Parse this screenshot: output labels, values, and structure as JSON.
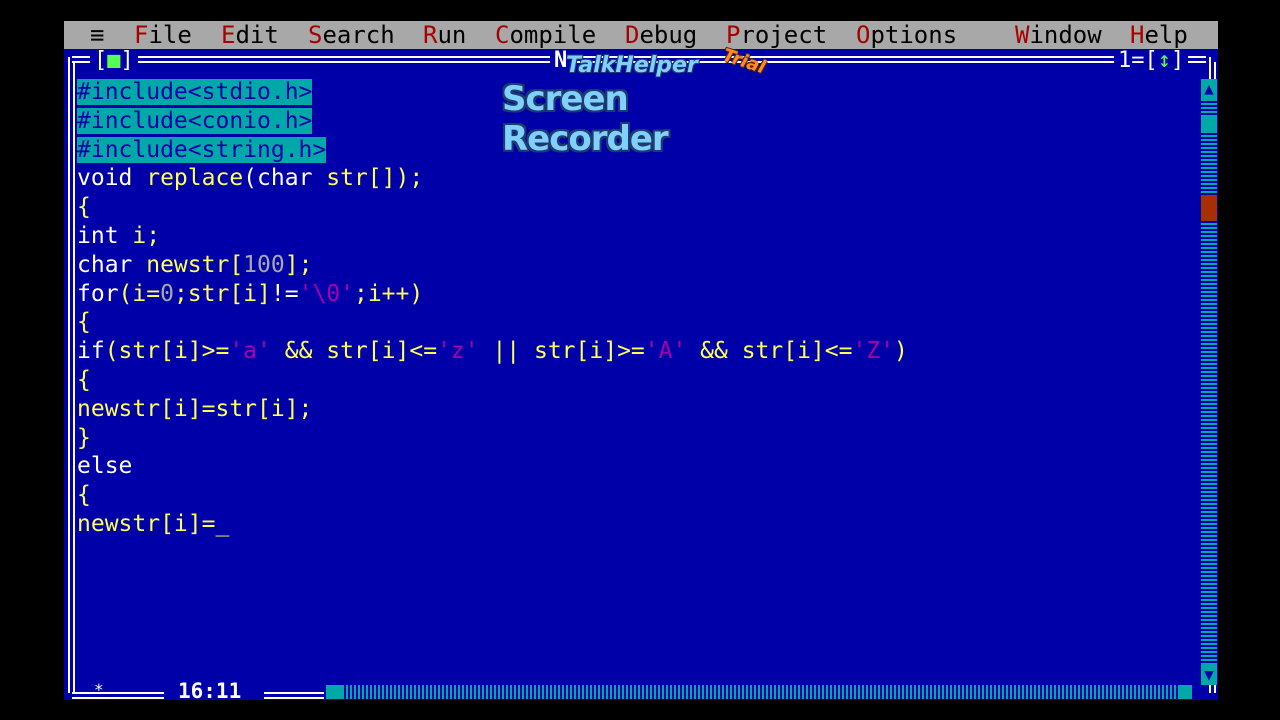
{
  "menu": {
    "system": "≡",
    "items": [
      {
        "hot": "F",
        "rest": "ile"
      },
      {
        "hot": "E",
        "rest": "dit"
      },
      {
        "hot": "S",
        "rest": "earch"
      },
      {
        "hot": "R",
        "rest": "un"
      },
      {
        "hot": "C",
        "rest": "ompile"
      },
      {
        "hot": "D",
        "rest": "ebug"
      },
      {
        "hot": "P",
        "rest": "roject"
      },
      {
        "hot": "O",
        "rest": "ptions"
      },
      {
        "hot": "W",
        "rest": "indow"
      },
      {
        "hot": "H",
        "rest": "elp"
      }
    ]
  },
  "window": {
    "close_left": "[",
    "close_box": "■",
    "close_right": "]",
    "file_name": "N",
    "number": "1",
    "zoom_arrow": "↕"
  },
  "watermark": {
    "top": "TalkHelper",
    "trial": "Trial",
    "bottom": "Screen Recorder"
  },
  "status": {
    "modified_mark": "*",
    "cursor_position": "16:11"
  },
  "code": {
    "line1": "#include<stdio.h>",
    "line2": "#include<conio.h>",
    "line3": "#include<string.h>",
    "line4_kw": "void",
    "line4_id": " replace",
    "line4_paren": "(",
    "line4_kw2": "char",
    "line4_rest": " str[]);",
    "line5": "{",
    "line6_kw": "int",
    "line6_rest": " i;",
    "line7_kw": "char",
    "line7_id": " newstr[",
    "line7_num": "100",
    "line7_rest": "];",
    "line8_kw": "for",
    "line8_a": "(i=",
    "line8_num": "0",
    "line8_b": ";str[i]",
    "line8_c": "!=",
    "line8_str": "'\\0'",
    "line8_d": ";i++)",
    "line9": "{",
    "line10_kw": "if",
    "line10_a": "(str[i]>=",
    "line10_s1": "'a'",
    "line10_b": " && str[i]<=",
    "line10_s2": "'z'",
    "line10_c": " || str[i]>=",
    "line10_s3": "'A'",
    "line10_d": " && str[i]<=",
    "line10_s4": "'Z'",
    "line10_e": ")",
    "line11": "{",
    "line12": "newstr[i]=str[i];",
    "line13": "}",
    "line14": "else",
    "line15": "{",
    "line16": "newstr[i]=",
    "caret": "_"
  }
}
